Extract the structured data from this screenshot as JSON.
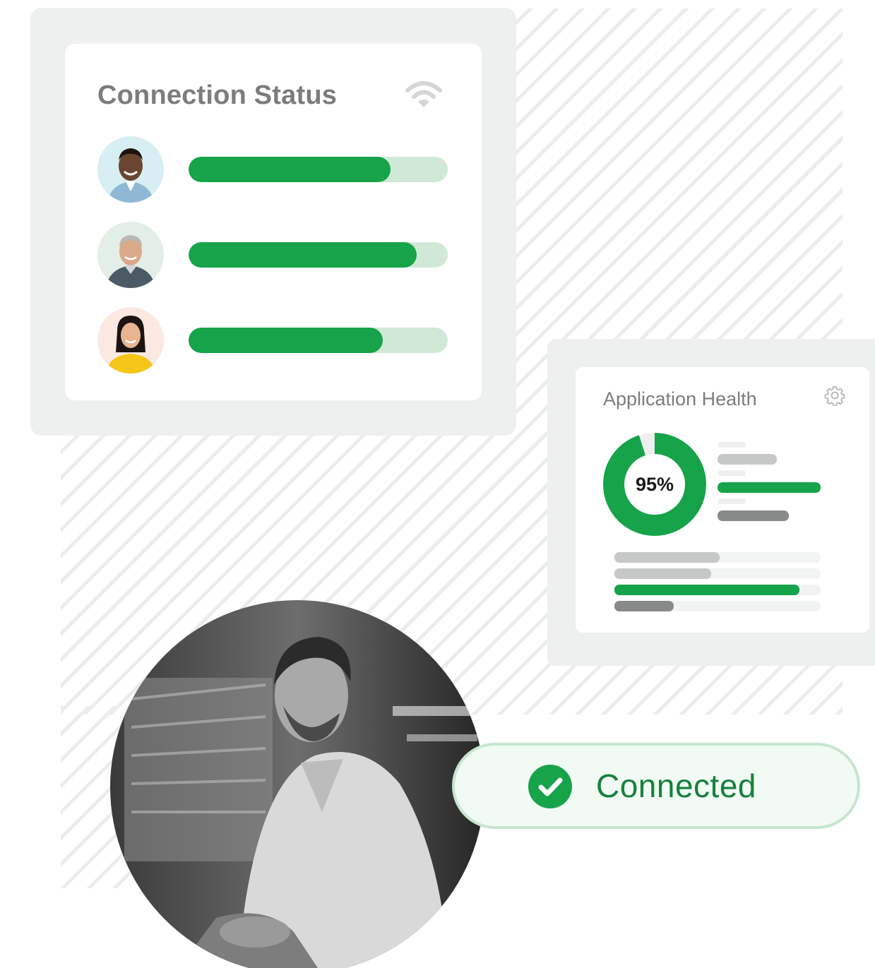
{
  "connection_status": {
    "title": "Connection Status",
    "icon": "wifi-icon",
    "users": [
      {
        "avatar": "avatar-man-smiling",
        "progress": 0.78
      },
      {
        "avatar": "avatar-older-man",
        "progress": 0.88
      },
      {
        "avatar": "avatar-woman-yellow-top",
        "progress": 0.75
      }
    ]
  },
  "application_health": {
    "title": "Application Health",
    "icon": "gear-icon",
    "donut_value": "95%",
    "donut_fraction": 0.95
  },
  "badge": {
    "label": "Connected",
    "icon": "check-circle-icon"
  },
  "colors": {
    "accent_green": "#16a34a",
    "track_green": "#cfe9d6",
    "frame_gray": "#eef0ef",
    "text_gray": "#7b7d7c"
  }
}
